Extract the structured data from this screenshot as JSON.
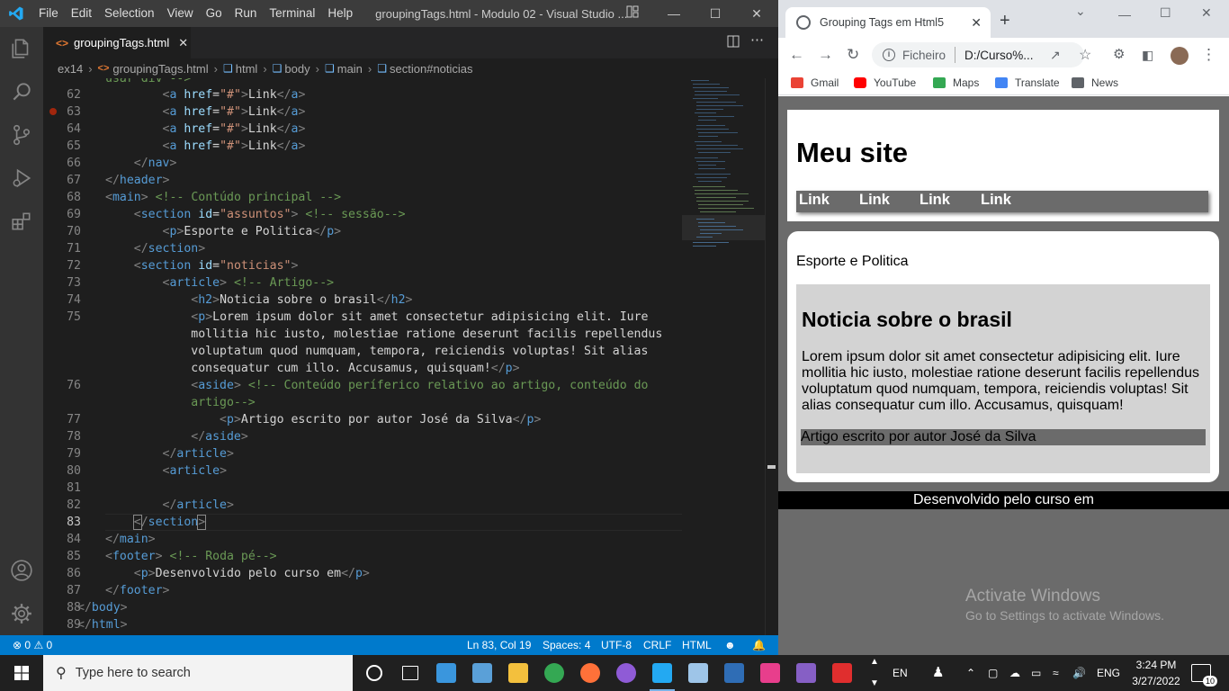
{
  "vscode": {
    "menu": [
      "File",
      "Edit",
      "Selection",
      "View",
      "Go",
      "Run",
      "Terminal",
      "Help"
    ],
    "window_title": "groupingTags.html - Modulo 02 - Visual Studio ...",
    "tab": {
      "label": "groupingTags.html",
      "icon": "html-file-icon"
    },
    "breadcrumb": [
      "ex14",
      "groupingTags.html",
      "html",
      "body",
      "main",
      "section#noticias"
    ],
    "line_numbers": [
      "62",
      "63",
      "64",
      "65",
      "66",
      "67",
      "68",
      "69",
      "70",
      "71",
      "72",
      "73",
      "74",
      "75",
      "",
      "",
      "",
      "76",
      "",
      "77",
      "78",
      "79",
      "80",
      "81",
      "82",
      "83",
      "84",
      "85",
      "86",
      "87",
      "88",
      "89"
    ],
    "status": {
      "errors": "0",
      "warnings": "0",
      "position": "Ln 83, Col 19",
      "spaces": "Spaces: 4",
      "encoding": "UTF-8",
      "eol": "CRLF",
      "language": "HTML"
    },
    "partial_top_line": "usar div -->"
  },
  "chrome": {
    "tab_title": "Grouping Tags em Html5",
    "url_scheme": "Ficheiro",
    "url": "D:/Curso%...",
    "bookmarks": [
      "Gmail",
      "YouTube",
      "Maps",
      "Translate",
      "News"
    ],
    "bookmark_colors": [
      "#ea4335",
      "#ff0000",
      "#34a853",
      "#4285f4",
      "#5f6368"
    ]
  },
  "site": {
    "title": "Meu site",
    "nav_links": [
      "Link",
      "Link",
      "Link",
      "Link"
    ],
    "subject": "Esporte e Politica",
    "article_title": "Noticia sobre o brasil",
    "article_body": "Lorem ipsum dolor sit amet consectetur adipisicing elit. Iure mollitia hic iusto, molestiae ratione deserunt facilis repellendus voluptatum quod numquam, tempora, reiciendis voluptas! Sit alias consequatur cum illo. Accusamus, quisquam!",
    "aside_text": "Artigo escrito por autor José da Silva",
    "footer_text": "Desenvolvido pelo curso em"
  },
  "watermark": {
    "line1": "Activate Windows",
    "line2": "Go to Settings to activate Windows."
  },
  "taskbar": {
    "search_placeholder": "Type here to search",
    "language_short": "EN",
    "language": "ENG",
    "time": "3:24 PM",
    "date": "3/27/2022",
    "notifications": "10",
    "apps": [
      {
        "name": "cortana-icon",
        "color": "#ffffff"
      },
      {
        "name": "task-view-icon",
        "color": "#ffffff"
      },
      {
        "name": "news-widget-icon",
        "color": "#3a96dd"
      },
      {
        "name": "desktop-app-icon",
        "color": "#5aa0d8"
      },
      {
        "name": "file-explorer-icon",
        "color": "#f3c03d"
      },
      {
        "name": "chrome-icon",
        "color": "#34a853"
      },
      {
        "name": "firefox-icon",
        "color": "#ff7139"
      },
      {
        "name": "github-desktop-icon",
        "color": "#8f5bd6"
      },
      {
        "name": "vscode-icon",
        "color": "#23a9f2"
      },
      {
        "name": "virtualbox-icon",
        "color": "#9ec5e8"
      },
      {
        "name": "sourcetree-icon",
        "color": "#2f6db5"
      },
      {
        "name": "wamp-icon",
        "color": "#e83e8c"
      },
      {
        "name": "visual-studio-icon",
        "color": "#865fc5"
      },
      {
        "name": "acrobat-icon",
        "color": "#e02e2e"
      }
    ]
  }
}
